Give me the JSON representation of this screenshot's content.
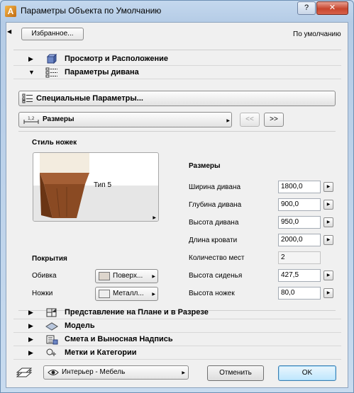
{
  "window": {
    "title": "Параметры Объекта по Умолчанию",
    "close_label": "✕",
    "help_label": "?"
  },
  "toolbar": {
    "favorites_label": "Избранное...",
    "default_label": "По умолчанию"
  },
  "panels": [
    {
      "label": "Просмотр и Расположение",
      "expanded": false,
      "icon": "box-3d-icon"
    },
    {
      "label": "Параметры дивана",
      "expanded": true,
      "icon": "parameters-list-icon"
    }
  ],
  "special_params_label": "Специальные Параметры...",
  "sizes_dropdown": {
    "label": "Размеры",
    "icon": "dimensions-icon"
  },
  "nav": {
    "prev": "<<",
    "next": ">>"
  },
  "leg_style": {
    "heading": "Стиль ножек",
    "preview_label": "Тип 5"
  },
  "coverings": {
    "heading": "Покрытия",
    "items": [
      {
        "label": "Обивка",
        "value": "Поверх...",
        "swatch": "#ddd5cc"
      },
      {
        "label": "Ножки",
        "value": "Металл...",
        "swatch": "#eeeeee"
      }
    ]
  },
  "dimensions": {
    "heading": "Размеры",
    "rows": [
      {
        "label": "Ширина дивана",
        "value": "1800,0",
        "enabled": true
      },
      {
        "label": "Глубина дивана",
        "value": "900,0",
        "enabled": true
      },
      {
        "label": "Высота дивана",
        "value": "950,0",
        "enabled": true
      },
      {
        "label": "Длина кровати",
        "value": "2000,0",
        "enabled": true
      },
      {
        "label": "Количество мест",
        "value": "2",
        "enabled": false
      },
      {
        "label": "Высота сиденья",
        "value": "427,5",
        "enabled": true
      },
      {
        "label": "Высота ножек",
        "value": "80,0",
        "enabled": true
      }
    ]
  },
  "lower_panels": [
    {
      "label": "Представление на Плане и в Разрезе",
      "icon": "plan-section-icon"
    },
    {
      "label": "Модель",
      "icon": "model-icon"
    },
    {
      "label": "Смета и Выносная Надпись",
      "icon": "listing-label-icon"
    },
    {
      "label": "Метки и Категории",
      "icon": "tags-categories-icon"
    }
  ],
  "footer": {
    "layer": "Интерьер - Мебель",
    "cancel_label": "Отменить",
    "ok_label": "OK"
  }
}
